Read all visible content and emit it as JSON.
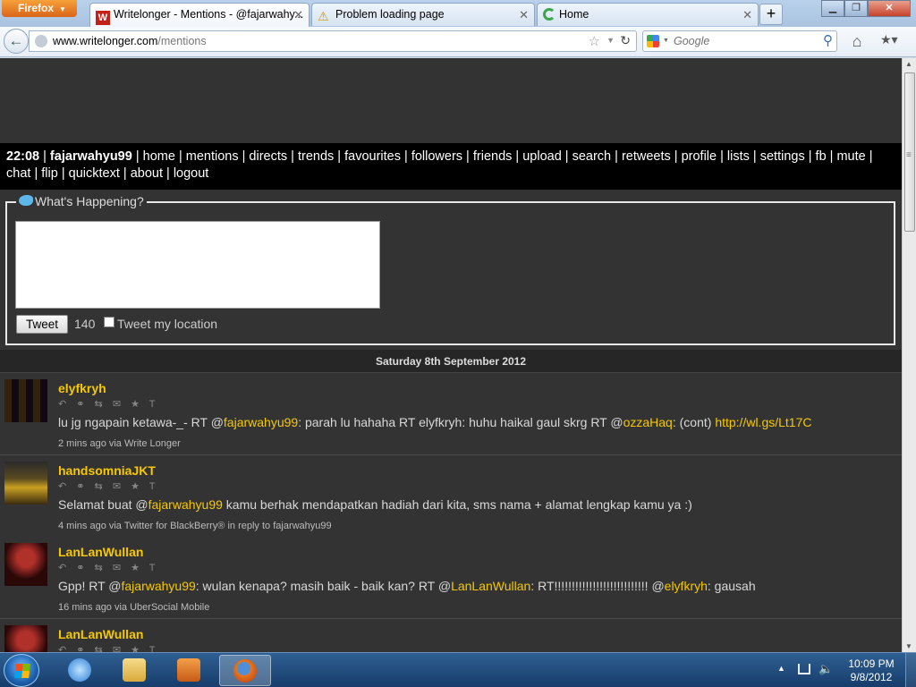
{
  "browser": {
    "menu_label": "Firefox",
    "tabs": [
      {
        "label": "Writelonger - Mentions - @fajarwahy...",
        "icon": "writelonger-icon"
      },
      {
        "label": "Problem loading page",
        "icon": "warning-icon"
      },
      {
        "label": "Home",
        "icon": "loading-icon"
      }
    ],
    "url_host": "www.writelonger.com",
    "url_path": "/mentions",
    "search_placeholder": "Google"
  },
  "page": {
    "nav": {
      "time": "22:08",
      "user": "fajarwahyu99",
      "links": [
        "home",
        "mentions",
        "directs",
        "trends",
        "favourites",
        "followers",
        "friends",
        "upload",
        "search",
        "retweets",
        "profile",
        "lists",
        "settings",
        "fb",
        "mute",
        "chat",
        "flip",
        "quicktext",
        "about",
        "logout"
      ]
    },
    "compose": {
      "legend": "What's Happening?",
      "button": "Tweet",
      "count": "140",
      "location_label": "Tweet my location"
    },
    "date_header": "Saturday 8th September 2012",
    "tweets": [
      {
        "user": "elyfkryh",
        "actions": "↶ ⚭ ⇆ ✉ ★ T",
        "parts": [
          {
            "t": "lu jg ngapain ketawa-_- RT @",
            "c": "text"
          },
          {
            "t": "fajarwahyu99",
            "c": "mention"
          },
          {
            "t": ": parah lu hahaha RT elyfkryh: huhu haikal gaul skrg RT @",
            "c": "text"
          },
          {
            "t": "ozzaHaq",
            "c": "mention"
          },
          {
            "t": ": (cont) ",
            "c": "text"
          },
          {
            "t": "http://wl.gs/Lt17C",
            "c": "link"
          }
        ],
        "meta": "2 mins ago via Write Longer"
      },
      {
        "user": "handsomniaJKT",
        "actions": "↶ ⚭ ⇆ ✉ ★ T",
        "parts": [
          {
            "t": "Selamat buat @",
            "c": "text"
          },
          {
            "t": "fajarwahyu99",
            "c": "mention"
          },
          {
            "t": " kamu berhak mendapatkan hadiah dari kita, sms nama + alamat lengkap kamu ya :)",
            "c": "text"
          }
        ],
        "meta": "4 mins ago via Twitter for BlackBerry® in reply to fajarwahyu99"
      },
      {
        "user": "LanLanWullan",
        "actions": "↶ ⚭ ⇆ ✉ ★ T",
        "parts": [
          {
            "t": "Gpp! RT @",
            "c": "text"
          },
          {
            "t": "fajarwahyu99",
            "c": "mention"
          },
          {
            "t": ": wulan kenapa? masih baik - baik kan? RT @",
            "c": "text"
          },
          {
            "t": "LanLanWullan",
            "c": "mention"
          },
          {
            "t": ": RT!!!!!!!!!!!!!!!!!!!!!!!!!!! @",
            "c": "text"
          },
          {
            "t": "elyfkryh",
            "c": "mention"
          },
          {
            "t": ": gausah",
            "c": "text"
          }
        ],
        "meta": "16 mins ago via UberSocial Mobile"
      },
      {
        "user": "LanLanWullan",
        "actions": "↶ ⚭ ⇆ ✉ ★ T",
        "parts": [],
        "meta": ""
      }
    ]
  },
  "taskbar": {
    "apps": [
      "internet-explorer-icon",
      "windows-explorer-icon",
      "media-player-icon",
      "firefox-icon"
    ],
    "time": "10:09 PM",
    "date": "9/8/2012"
  },
  "colors": {
    "page_bg": "#333333",
    "nav_bg": "#000000",
    "accent_username": "#f5c800",
    "text": "#d8d8d8"
  }
}
